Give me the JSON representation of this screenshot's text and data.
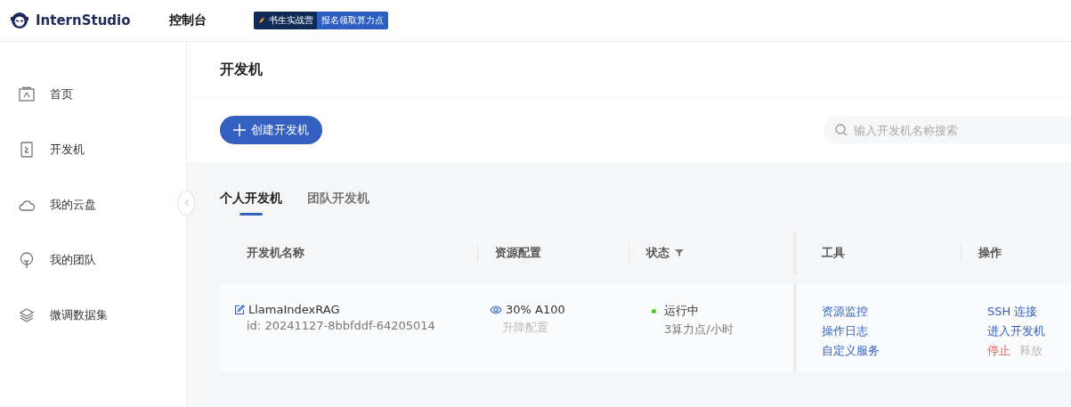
{
  "header": {
    "brand": "InternStudio",
    "nav": "控制台",
    "promo": {
      "left": "书生实战营",
      "right": "报名领取算力点"
    }
  },
  "sidebar": {
    "items": [
      {
        "label": "首页"
      },
      {
        "label": "开发机"
      },
      {
        "label": "我的云盘"
      },
      {
        "label": "我的团队"
      },
      {
        "label": "微调数据集"
      }
    ]
  },
  "page_title": "开发机",
  "create_button": "创建开发机",
  "search": {
    "placeholder": "输入开发机名称搜索"
  },
  "tabs": [
    {
      "label": "个人开发机",
      "selected": true
    },
    {
      "label": "团队开发机",
      "selected": false
    }
  ],
  "table": {
    "columns": [
      "开发机名称",
      "资源配置",
      "状态",
      "工具",
      "操作"
    ],
    "rows": [
      {
        "name": "LlamaIndexRAG",
        "id": "id: 20241127-8bbfddf-64205014",
        "resource": "30% A100",
        "resource_action": "升降配置",
        "status": {
          "text": "运行中",
          "kind": "running"
        },
        "cost": "3算力点/小时",
        "tools": [
          "资源监控",
          "操作日志",
          "自定义服务"
        ],
        "actions": [
          {
            "label": "SSH 连接",
            "kind": "link"
          },
          {
            "label": "进入开发机",
            "kind": "link"
          },
          {
            "label": "停止",
            "kind": "danger"
          },
          {
            "label": "释放",
            "kind": "disabled"
          }
        ]
      }
    ]
  }
}
